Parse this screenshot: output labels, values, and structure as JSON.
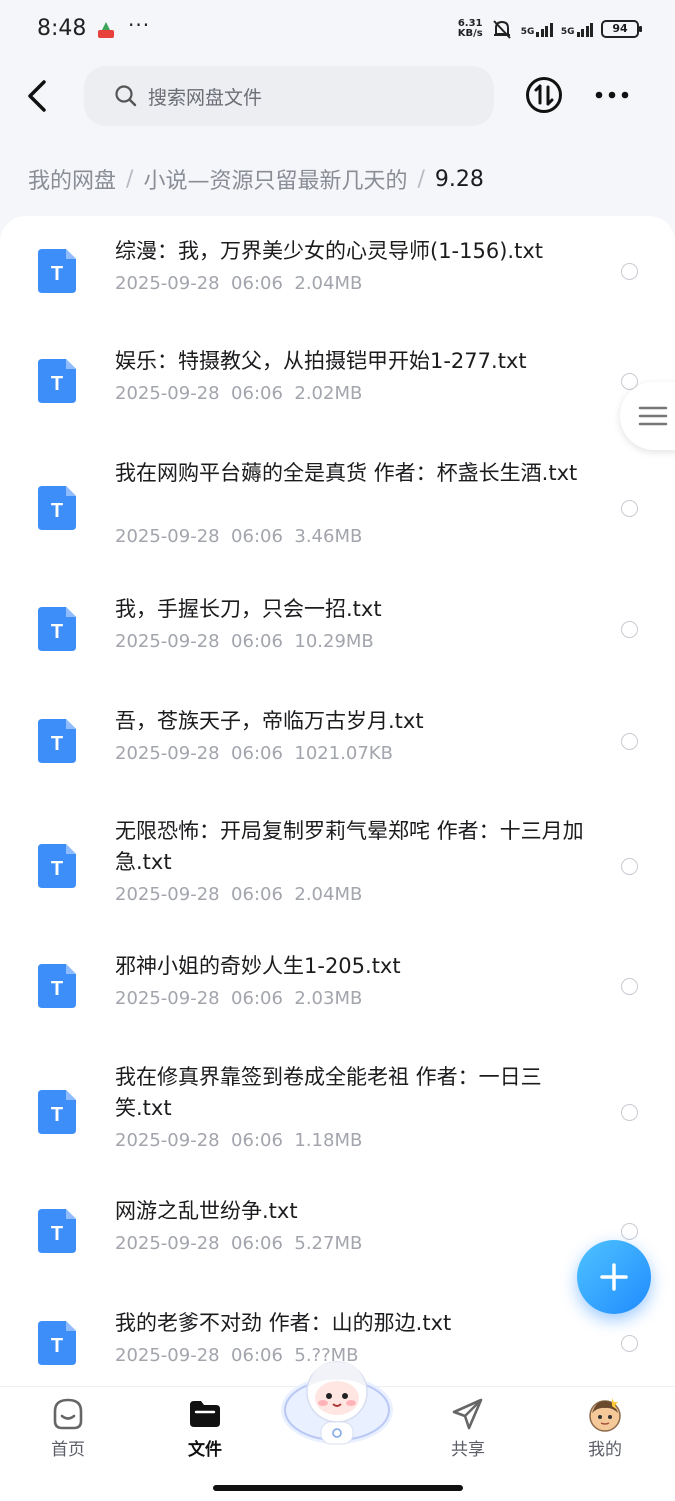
{
  "status": {
    "time": "8:48",
    "net_speed_value": "6.31",
    "net_speed_unit": "KB/s",
    "signal1": "5G",
    "signal2": "5G",
    "battery": "94"
  },
  "search": {
    "placeholder": "搜索网盘文件"
  },
  "breadcrumb": {
    "root": "我的网盘",
    "folder": "小说—资源只留最新几天的",
    "current": "9.28",
    "separator": "/"
  },
  "files": [
    {
      "name": "综漫：我，万界美少女的心灵导师(1-156).txt",
      "date": "2025-09-28",
      "time": "06:06",
      "size": "2.04MB",
      "icon_letter": "T"
    },
    {
      "name": "娱乐：特摄教父，从拍摄铠甲开始1-277.txt",
      "date": "2025-09-28",
      "time": "06:06",
      "size": "2.02MB",
      "icon_letter": "T"
    },
    {
      "name": "我在网购平台薅的全是真货 作者：杯盏长生酒.txt",
      "date": "2025-09-28",
      "time": "06:06",
      "size": "3.46MB",
      "icon_letter": "T"
    },
    {
      "name": "我，手握长刀，只会一招.txt",
      "date": "2025-09-28",
      "time": "06:06",
      "size": "10.29MB",
      "icon_letter": "T"
    },
    {
      "name": "吾，苍族天子，帝临万古岁月.txt",
      "date": "2025-09-28",
      "time": "06:06",
      "size": "1021.07KB",
      "icon_letter": "T"
    },
    {
      "name": "无限恐怖：开局复制罗莉气晕郑咤 作者：十三月加急.txt",
      "date": "2025-09-28",
      "time": "06:06",
      "size": "2.04MB",
      "icon_letter": "T"
    },
    {
      "name": "邪神小姐的奇妙人生1-205.txt",
      "date": "2025-09-28",
      "time": "06:06",
      "size": "2.03MB",
      "icon_letter": "T"
    },
    {
      "name": "我在修真界靠签到卷成全能老祖 作者：一日三笑.txt",
      "date": "2025-09-28",
      "time": "06:06",
      "size": "1.18MB",
      "icon_letter": "T"
    },
    {
      "name": "网游之乱世纷争.txt",
      "date": "2025-09-28",
      "time": "06:06",
      "size": "5.27MB",
      "icon_letter": "T"
    },
    {
      "name": "我的老爹不对劲 作者：山的那边.txt",
      "date": "2025-09-28",
      "time": "06:06",
      "size": "5.??MB",
      "icon_letter": "T"
    }
  ],
  "nav": {
    "home": "首页",
    "files": "文件",
    "share": "共享",
    "mine": "我的"
  },
  "colors": {
    "accent": "#1f8bff",
    "file_icon": "#3d8ef8",
    "meta_text": "#a3a5ad"
  }
}
